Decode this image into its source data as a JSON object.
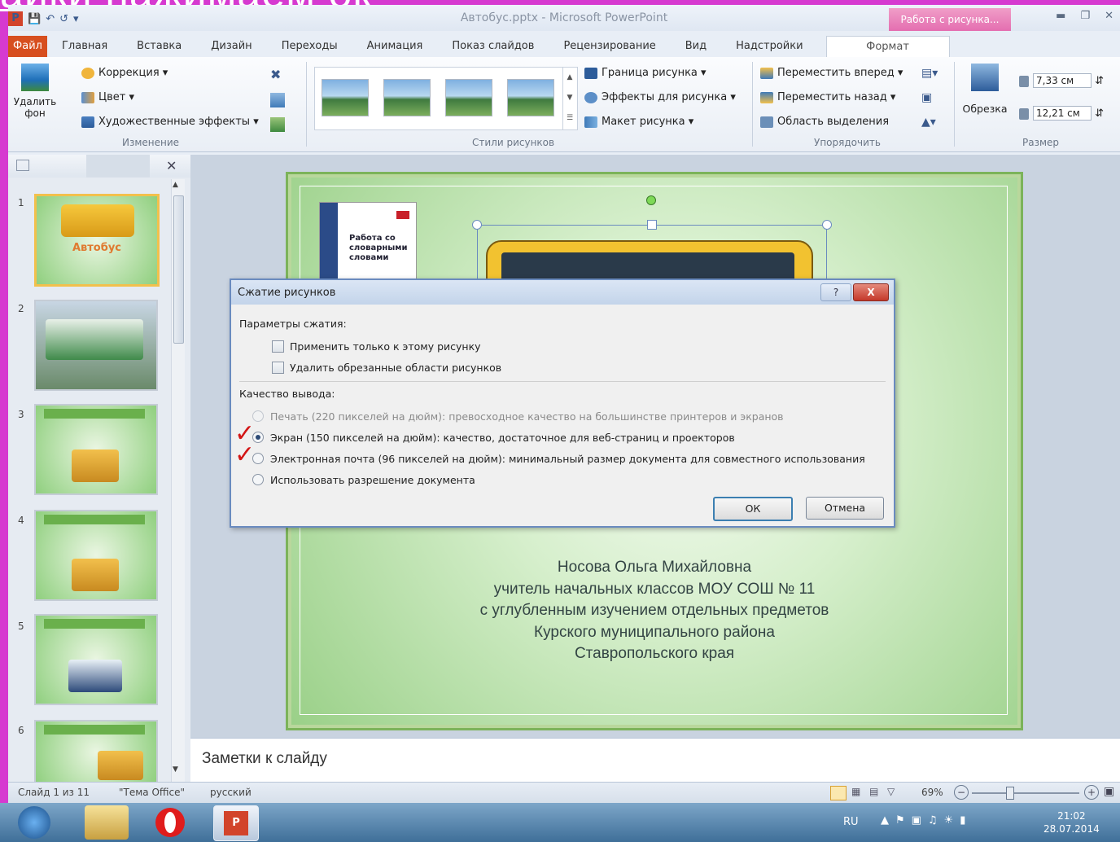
{
  "background_title": "айки нажимаем ок",
  "window": {
    "title": "Автобус.pptx - Microsoft PowerPoint",
    "contextual_tab": "Работа с рисунка..."
  },
  "ribbon": {
    "tabs": [
      "Файл",
      "Главная",
      "Вставка",
      "Дизайн",
      "Переходы",
      "Анимация",
      "Показ слайдов",
      "Рецензирование",
      "Вид",
      "Надстройки",
      "Формат"
    ],
    "remove_bg": "Удалить фон",
    "correction": "Коррекция",
    "color": "Цвет",
    "artistic": "Художественные эффекты",
    "group_change": "Изменение",
    "group_styles": "Стили рисунков",
    "border": "Граница рисунка",
    "effects": "Эффекты для рисунка",
    "layout": "Макет рисунка",
    "bring_forward": "Переместить вперед",
    "send_backward": "Переместить назад",
    "selection_pane": "Область выделения",
    "group_arrange": "Упорядочить",
    "crop": "Обрезка",
    "height": "7,33 см",
    "width": "12,21 см",
    "group_size": "Размер"
  },
  "slides_panel": {
    "numbers": [
      "1",
      "2",
      "3",
      "4",
      "5",
      "6"
    ],
    "slide1_title": "Автобус"
  },
  "slide": {
    "book_title": "Работа со словарными словами",
    "author_lines": [
      "Носова Ольга Михайловна",
      "учитель начальных классов МОУ СОШ № 11",
      "с углубленным изучением отдельных предметов",
      "Курского муниципального района",
      "Ставропольского края"
    ]
  },
  "dialog": {
    "title": "Сжатие рисунков",
    "help": "?",
    "close": "X",
    "params_label": "Параметры сжатия:",
    "opt_apply_only": "Применить только к этому рисунку",
    "opt_delete_cropped": "Удалить обрезанные области рисунков",
    "quality_label": "Качество вывода:",
    "q_print": "Печать (220 пикселей на дюйм): превосходное качество на большинстве принтеров и экранов",
    "q_screen": "Экран (150 пикселей на дюйм): качество, достаточное для веб-страниц и проекторов",
    "q_email": "Электронная почта (96 пикселей на дюйм): минимальный размер документа для совместного использования",
    "q_doc": "Использовать разрешение документа",
    "ok": "ОК",
    "cancel": "Отмена",
    "selected_option": "q_screen",
    "annotation_mark": "✓"
  },
  "notes": {
    "placeholder": "Заметки к слайду"
  },
  "status": {
    "slide_count": "Слайд 1 из 11",
    "theme": "\"Тема Office\"",
    "language": "русский",
    "zoom": "69%"
  },
  "taskbar": {
    "lang": "RU",
    "time": "21:02",
    "date": "28.07.2014"
  },
  "colors": {
    "file_tab": "#d74f1f",
    "contextual_tab": "#e46eb0",
    "annotation": "#d31616",
    "background": "#d63ad0"
  }
}
